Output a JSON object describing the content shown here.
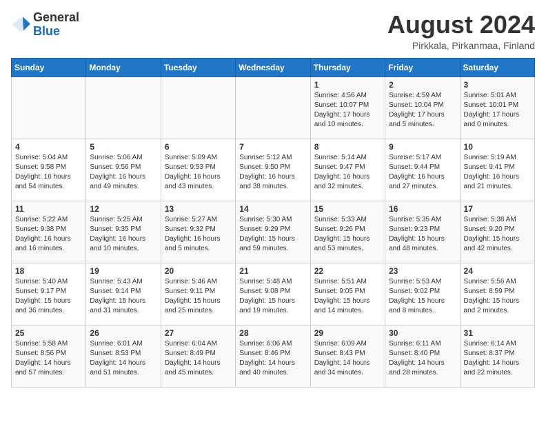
{
  "header": {
    "logo": {
      "general": "General",
      "blue": "Blue"
    },
    "month_year": "August 2024",
    "location": "Pirkkala, Pirkanmaa, Finland"
  },
  "calendar": {
    "weekdays": [
      "Sunday",
      "Monday",
      "Tuesday",
      "Wednesday",
      "Thursday",
      "Friday",
      "Saturday"
    ],
    "weeks": [
      [
        {
          "day": "",
          "info": ""
        },
        {
          "day": "",
          "info": ""
        },
        {
          "day": "",
          "info": ""
        },
        {
          "day": "",
          "info": ""
        },
        {
          "day": "1",
          "info": "Sunrise: 4:56 AM\nSunset: 10:07 PM\nDaylight: 17 hours\nand 10 minutes."
        },
        {
          "day": "2",
          "info": "Sunrise: 4:59 AM\nSunset: 10:04 PM\nDaylight: 17 hours\nand 5 minutes."
        },
        {
          "day": "3",
          "info": "Sunrise: 5:01 AM\nSunset: 10:01 PM\nDaylight: 17 hours\nand 0 minutes."
        }
      ],
      [
        {
          "day": "4",
          "info": "Sunrise: 5:04 AM\nSunset: 9:58 PM\nDaylight: 16 hours\nand 54 minutes."
        },
        {
          "day": "5",
          "info": "Sunrise: 5:06 AM\nSunset: 9:56 PM\nDaylight: 16 hours\nand 49 minutes."
        },
        {
          "day": "6",
          "info": "Sunrise: 5:09 AM\nSunset: 9:53 PM\nDaylight: 16 hours\nand 43 minutes."
        },
        {
          "day": "7",
          "info": "Sunrise: 5:12 AM\nSunset: 9:50 PM\nDaylight: 16 hours\nand 38 minutes."
        },
        {
          "day": "8",
          "info": "Sunrise: 5:14 AM\nSunset: 9:47 PM\nDaylight: 16 hours\nand 32 minutes."
        },
        {
          "day": "9",
          "info": "Sunrise: 5:17 AM\nSunset: 9:44 PM\nDaylight: 16 hours\nand 27 minutes."
        },
        {
          "day": "10",
          "info": "Sunrise: 5:19 AM\nSunset: 9:41 PM\nDaylight: 16 hours\nand 21 minutes."
        }
      ],
      [
        {
          "day": "11",
          "info": "Sunrise: 5:22 AM\nSunset: 9:38 PM\nDaylight: 16 hours\nand 16 minutes."
        },
        {
          "day": "12",
          "info": "Sunrise: 5:25 AM\nSunset: 9:35 PM\nDaylight: 16 hours\nand 10 minutes."
        },
        {
          "day": "13",
          "info": "Sunrise: 5:27 AM\nSunset: 9:32 PM\nDaylight: 16 hours\nand 5 minutes."
        },
        {
          "day": "14",
          "info": "Sunrise: 5:30 AM\nSunset: 9:29 PM\nDaylight: 15 hours\nand 59 minutes."
        },
        {
          "day": "15",
          "info": "Sunrise: 5:33 AM\nSunset: 9:26 PM\nDaylight: 15 hours\nand 53 minutes."
        },
        {
          "day": "16",
          "info": "Sunrise: 5:35 AM\nSunset: 9:23 PM\nDaylight: 15 hours\nand 48 minutes."
        },
        {
          "day": "17",
          "info": "Sunrise: 5:38 AM\nSunset: 9:20 PM\nDaylight: 15 hours\nand 42 minutes."
        }
      ],
      [
        {
          "day": "18",
          "info": "Sunrise: 5:40 AM\nSunset: 9:17 PM\nDaylight: 15 hours\nand 36 minutes."
        },
        {
          "day": "19",
          "info": "Sunrise: 5:43 AM\nSunset: 9:14 PM\nDaylight: 15 hours\nand 31 minutes."
        },
        {
          "day": "20",
          "info": "Sunrise: 5:46 AM\nSunset: 9:11 PM\nDaylight: 15 hours\nand 25 minutes."
        },
        {
          "day": "21",
          "info": "Sunrise: 5:48 AM\nSunset: 9:08 PM\nDaylight: 15 hours\nand 19 minutes."
        },
        {
          "day": "22",
          "info": "Sunrise: 5:51 AM\nSunset: 9:05 PM\nDaylight: 15 hours\nand 14 minutes."
        },
        {
          "day": "23",
          "info": "Sunrise: 5:53 AM\nSunset: 9:02 PM\nDaylight: 15 hours\nand 8 minutes."
        },
        {
          "day": "24",
          "info": "Sunrise: 5:56 AM\nSunset: 8:59 PM\nDaylight: 15 hours\nand 2 minutes."
        }
      ],
      [
        {
          "day": "25",
          "info": "Sunrise: 5:58 AM\nSunset: 8:56 PM\nDaylight: 14 hours\nand 57 minutes."
        },
        {
          "day": "26",
          "info": "Sunrise: 6:01 AM\nSunset: 8:53 PM\nDaylight: 14 hours\nand 51 minutes."
        },
        {
          "day": "27",
          "info": "Sunrise: 6:04 AM\nSunset: 8:49 PM\nDaylight: 14 hours\nand 45 minutes."
        },
        {
          "day": "28",
          "info": "Sunrise: 6:06 AM\nSunset: 8:46 PM\nDaylight: 14 hours\nand 40 minutes."
        },
        {
          "day": "29",
          "info": "Sunrise: 6:09 AM\nSunset: 8:43 PM\nDaylight: 14 hours\nand 34 minutes."
        },
        {
          "day": "30",
          "info": "Sunrise: 6:11 AM\nSunset: 8:40 PM\nDaylight: 14 hours\nand 28 minutes."
        },
        {
          "day": "31",
          "info": "Sunrise: 6:14 AM\nSunset: 8:37 PM\nDaylight: 14 hours\nand 22 minutes."
        }
      ]
    ]
  }
}
